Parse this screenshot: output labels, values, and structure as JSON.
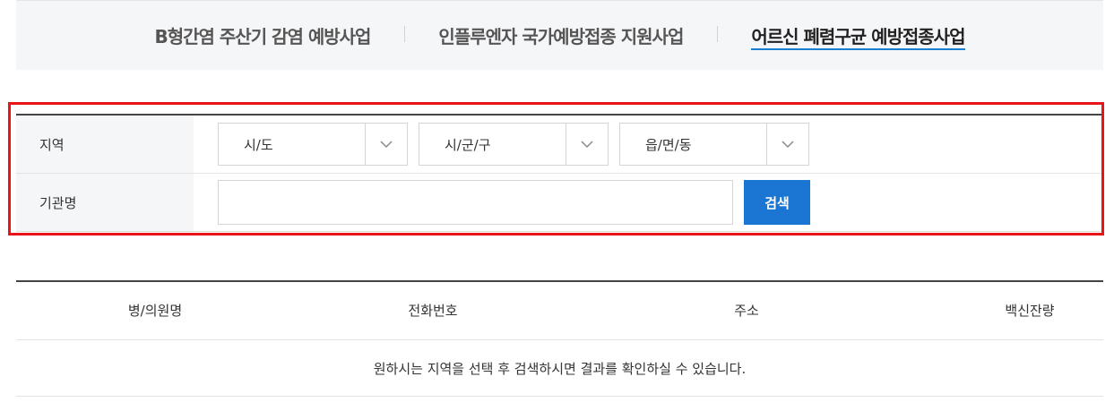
{
  "tabs": [
    {
      "label": "B형간염 주산기 감염 예방사업",
      "active": false
    },
    {
      "label": "인플루엔자 국가예방접종 지원사업",
      "active": false
    },
    {
      "label": "어르신 폐렴구균 예방접종사업",
      "active": true
    }
  ],
  "search": {
    "region_label": "지역",
    "selects": [
      {
        "selected": "시/도"
      },
      {
        "selected": "시/군/구"
      },
      {
        "selected": "읍/면/동"
      }
    ],
    "org_label": "기관명",
    "org_value": "",
    "search_button": "검색"
  },
  "table": {
    "headers": [
      "병/의원명",
      "전화번호",
      "주소",
      "백신잔량"
    ],
    "empty_message": "원하시는 지역을 선택 후 검색하시면 결과를 확인하실 수 있습니다."
  },
  "colors": {
    "accent": "#1a76d2",
    "highlight": "#e8141a"
  }
}
